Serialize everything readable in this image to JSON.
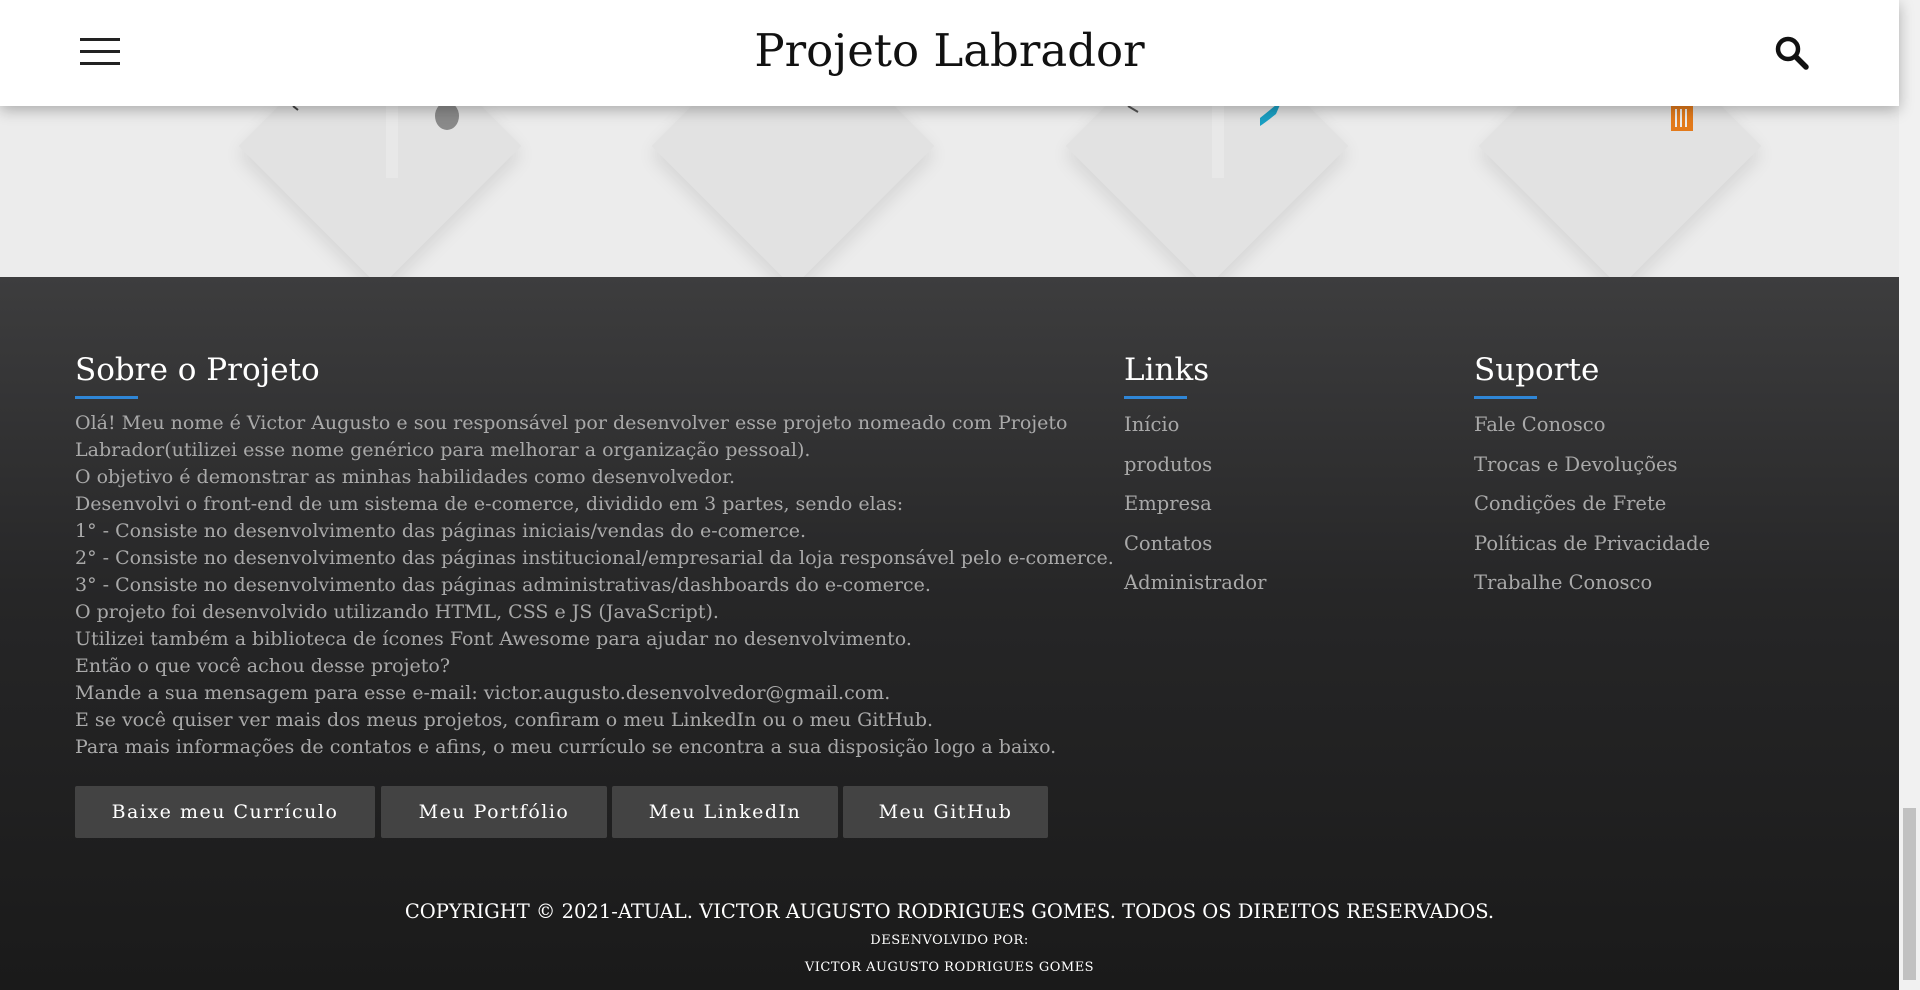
{
  "header": {
    "title": "Projeto Labrador",
    "menu_icon": "hamburger-menu-icon",
    "search_icon": "search-icon"
  },
  "footer": {
    "about": {
      "title": "Sobre o Projeto",
      "lines": [
        "Olá! Meu nome é Victor Augusto e sou responsável por desenvolver esse projeto nomeado com Projeto",
        "Labrador(utilizei esse nome genérico para melhorar a organização pessoal).",
        "O objetivo é demonstrar as minhas habilidades como desenvolvedor.",
        "Desenvolvi o front-end de um sistema de e-comerce, dividido em 3 partes, sendo elas:",
        "1° - Consiste no desenvolvimento das páginas iniciais/vendas do e-comerce.",
        "2° - Consiste no desenvolvimento das páginas institucional/empresarial da loja responsável pelo e-comerce.",
        "3° - Consiste no desenvolvimento das páginas administrativas/dashboards do e-comerce.",
        "O projeto foi desenvolvido utilizando HTML, CSS e JS (JavaScript).",
        "Utilizei também a biblioteca de ícones Font Awesome para ajudar no desenvolvimento.",
        "Então o que você achou desse projeto?",
        "Mande a sua mensagem para esse e-mail: victor.augusto.desenvolvedor@gmail.com.",
        "E se você quiser ver mais dos meus projetos, confiram o meu LinkedIn ou o meu GitHub.",
        "Para mais informações de contatos e afins, o meu currículo se encontra a sua disposição logo a baixo."
      ],
      "buttons": [
        "Baixe meu Currículo",
        "Meu Portfólio",
        "Meu LinkedIn",
        "Meu GitHub"
      ]
    },
    "links": {
      "title": "Links",
      "items": [
        "Início",
        "produtos",
        "Empresa",
        "Contatos",
        "Administrador"
      ]
    },
    "support": {
      "title": "Suporte",
      "items": [
        "Fale Conosco",
        "Trocas e Devoluções",
        "Condições de Frete",
        "Políticas de Privacidade",
        "Trabalhe Conosco"
      ]
    },
    "copyright": "COPYRIGHT © 2021-ATUAL. VICTOR AUGUSTO RODRIGUES GOMES. TODOS OS DIREITOS RESERVADOS.",
    "developed_by_label": "DESENVOLVIDO POR:",
    "developer_name": "VICTOR AUGUSTO RODRIGUES GOMES"
  },
  "colors": {
    "accent_underline": "#2f86d6",
    "button_bg": "#434343",
    "footer_text": "#a9a9a9"
  }
}
